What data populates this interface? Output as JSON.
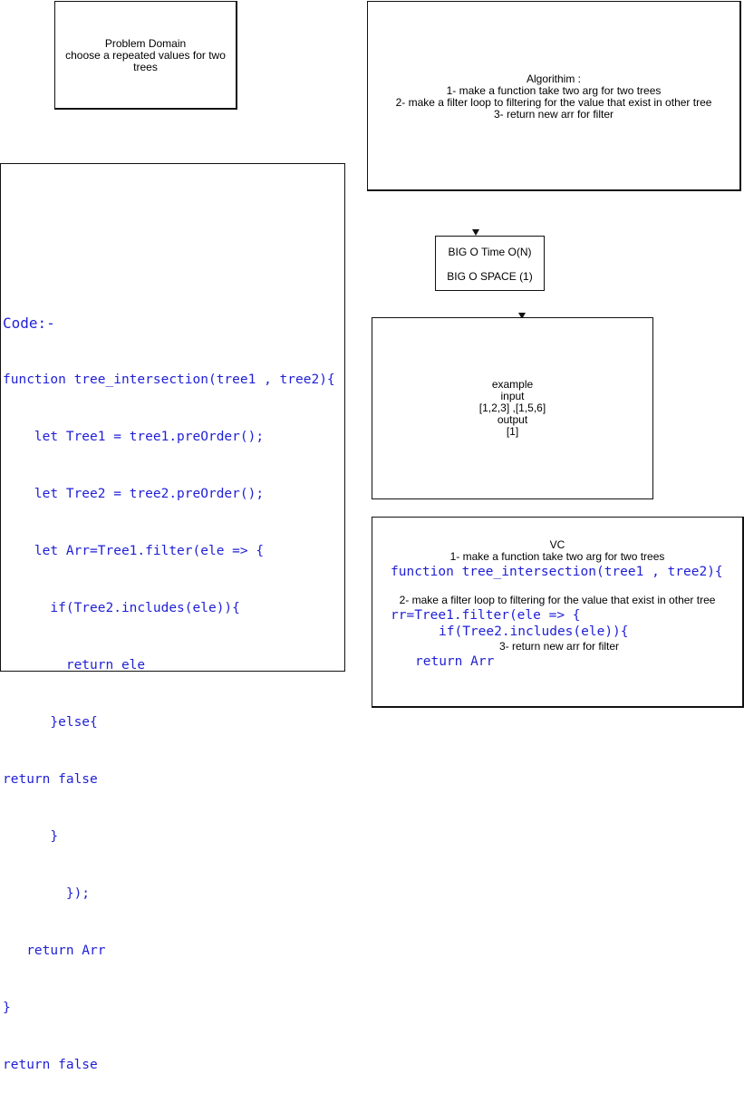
{
  "problem_domain": {
    "title": "Problem Domain",
    "line1": "choose a repeated values for two",
    "line2": "trees"
  },
  "algorithm": {
    "title": "Algorithim :",
    "step1": "1- make a function take two arg for two trees",
    "step2": "2- make a filter loop to filtering for the value that exist  in other tree",
    "step3": "3- return new arr for filter"
  },
  "code": {
    "lines": [
      "Code:-",
      "function tree_intersection(tree1 , tree2){",
      "    let Tree1 = tree1.preOrder();",
      "    let Tree2 = tree2.preOrder();",
      "    let Arr=Tree1.filter(ele => {",
      "      if(Tree2.includes(ele)){",
      "        return ele",
      "      }else{",
      "return false",
      "      }",
      "        });",
      "   return Arr",
      "}",
      "return false"
    ]
  },
  "big_o": {
    "time": "BIG O Time O(N)",
    "space": "BIG O SPACE (1)"
  },
  "example": {
    "title": "example",
    "input_label": "input",
    "input_value": "[1,2,3] ,[1,5,6]",
    "output_label": "output",
    "output_value": "[1]"
  },
  "vc": {
    "title": "VC",
    "step1": "1- make a function take two arg for two trees",
    "code1": "function tree_intersection(tree1 , tree2){",
    "step2": "2- make a filter loop to filtering for the value that exist  in other tree",
    "code2": "rr=Tree1.filter(ele => {",
    "code3": "if(Tree2.includes(ele)){",
    "step3": "3- return new arr for filter",
    "code4": "return Arr"
  }
}
